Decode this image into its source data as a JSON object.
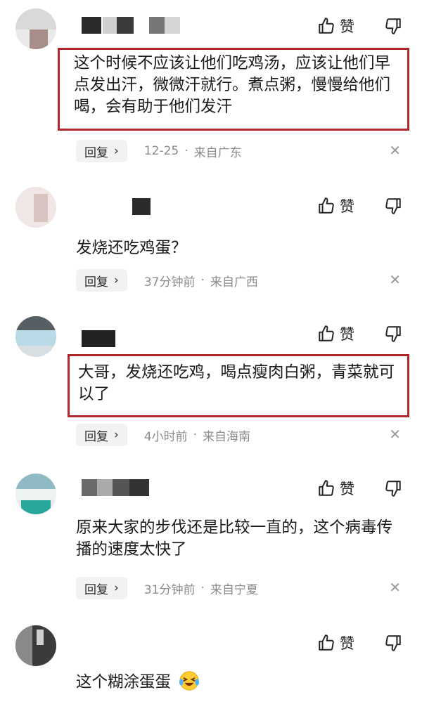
{
  "comments": [
    {
      "text": "这个时候不应该让他们吃鸡汤，应该让他们早点发出汗，微微汗就行。煮点粥，慢慢给他们喝，会有助于他们发汗",
      "like_label": "赞",
      "reply_label": "回复",
      "time": "12-25",
      "location": "来自广东"
    },
    {
      "text": "发烧还吃鸡蛋？",
      "like_label": "赞",
      "reply_label": "回复",
      "time": "37分钟前",
      "location": "来自广西"
    },
    {
      "text": "大哥，发烧还吃鸡，喝点瘦肉白粥，青菜就可以了",
      "like_label": "赞",
      "reply_label": "回复",
      "time": "4小时前",
      "location": "来自海南"
    },
    {
      "text": "原来大家的步伐还是比较一直的，这个病毒传播的速度太快了",
      "like_label": "赞",
      "reply_label": "回复",
      "time": "31分钟前",
      "location": "来自宁夏"
    },
    {
      "text": "这个糊涂蛋蛋",
      "like_label": "赞"
    }
  ],
  "icons": {
    "like": "thumb-up-icon",
    "dislike": "thumb-down-icon",
    "close": "close-icon",
    "chevron": "chevron-right-icon",
    "emoji": "laughing-crying-emoji"
  },
  "colors": {
    "highlight_border": "#b1262b",
    "meta_text": "#8c8c8c",
    "reply_bg": "#f2f2f2"
  }
}
